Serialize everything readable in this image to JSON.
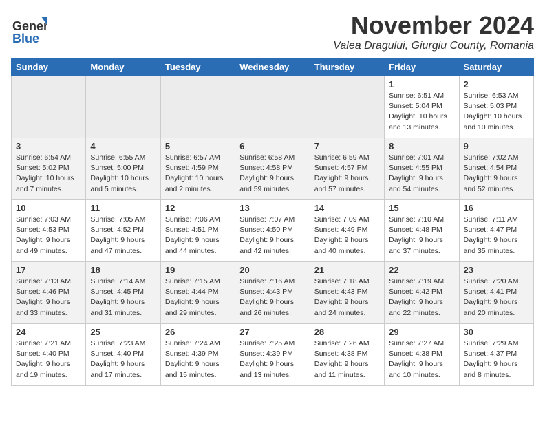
{
  "logo": {
    "general": "General",
    "blue": "Blue"
  },
  "title": "November 2024",
  "location": "Valea Dragului, Giurgiu County, Romania",
  "weekdays": [
    "Sunday",
    "Monday",
    "Tuesday",
    "Wednesday",
    "Thursday",
    "Friday",
    "Saturday"
  ],
  "weeks": [
    [
      {
        "day": "",
        "info": ""
      },
      {
        "day": "",
        "info": ""
      },
      {
        "day": "",
        "info": ""
      },
      {
        "day": "",
        "info": ""
      },
      {
        "day": "",
        "info": ""
      },
      {
        "day": "1",
        "info": "Sunrise: 6:51 AM\nSunset: 5:04 PM\nDaylight: 10 hours\nand 13 minutes."
      },
      {
        "day": "2",
        "info": "Sunrise: 6:53 AM\nSunset: 5:03 PM\nDaylight: 10 hours\nand 10 minutes."
      }
    ],
    [
      {
        "day": "3",
        "info": "Sunrise: 6:54 AM\nSunset: 5:02 PM\nDaylight: 10 hours\nand 7 minutes."
      },
      {
        "day": "4",
        "info": "Sunrise: 6:55 AM\nSunset: 5:00 PM\nDaylight: 10 hours\nand 5 minutes."
      },
      {
        "day": "5",
        "info": "Sunrise: 6:57 AM\nSunset: 4:59 PM\nDaylight: 10 hours\nand 2 minutes."
      },
      {
        "day": "6",
        "info": "Sunrise: 6:58 AM\nSunset: 4:58 PM\nDaylight: 9 hours\nand 59 minutes."
      },
      {
        "day": "7",
        "info": "Sunrise: 6:59 AM\nSunset: 4:57 PM\nDaylight: 9 hours\nand 57 minutes."
      },
      {
        "day": "8",
        "info": "Sunrise: 7:01 AM\nSunset: 4:55 PM\nDaylight: 9 hours\nand 54 minutes."
      },
      {
        "day": "9",
        "info": "Sunrise: 7:02 AM\nSunset: 4:54 PM\nDaylight: 9 hours\nand 52 minutes."
      }
    ],
    [
      {
        "day": "10",
        "info": "Sunrise: 7:03 AM\nSunset: 4:53 PM\nDaylight: 9 hours\nand 49 minutes."
      },
      {
        "day": "11",
        "info": "Sunrise: 7:05 AM\nSunset: 4:52 PM\nDaylight: 9 hours\nand 47 minutes."
      },
      {
        "day": "12",
        "info": "Sunrise: 7:06 AM\nSunset: 4:51 PM\nDaylight: 9 hours\nand 44 minutes."
      },
      {
        "day": "13",
        "info": "Sunrise: 7:07 AM\nSunset: 4:50 PM\nDaylight: 9 hours\nand 42 minutes."
      },
      {
        "day": "14",
        "info": "Sunrise: 7:09 AM\nSunset: 4:49 PM\nDaylight: 9 hours\nand 40 minutes."
      },
      {
        "day": "15",
        "info": "Sunrise: 7:10 AM\nSunset: 4:48 PM\nDaylight: 9 hours\nand 37 minutes."
      },
      {
        "day": "16",
        "info": "Sunrise: 7:11 AM\nSunset: 4:47 PM\nDaylight: 9 hours\nand 35 minutes."
      }
    ],
    [
      {
        "day": "17",
        "info": "Sunrise: 7:13 AM\nSunset: 4:46 PM\nDaylight: 9 hours\nand 33 minutes."
      },
      {
        "day": "18",
        "info": "Sunrise: 7:14 AM\nSunset: 4:45 PM\nDaylight: 9 hours\nand 31 minutes."
      },
      {
        "day": "19",
        "info": "Sunrise: 7:15 AM\nSunset: 4:44 PM\nDaylight: 9 hours\nand 29 minutes."
      },
      {
        "day": "20",
        "info": "Sunrise: 7:16 AM\nSunset: 4:43 PM\nDaylight: 9 hours\nand 26 minutes."
      },
      {
        "day": "21",
        "info": "Sunrise: 7:18 AM\nSunset: 4:43 PM\nDaylight: 9 hours\nand 24 minutes."
      },
      {
        "day": "22",
        "info": "Sunrise: 7:19 AM\nSunset: 4:42 PM\nDaylight: 9 hours\nand 22 minutes."
      },
      {
        "day": "23",
        "info": "Sunrise: 7:20 AM\nSunset: 4:41 PM\nDaylight: 9 hours\nand 20 minutes."
      }
    ],
    [
      {
        "day": "24",
        "info": "Sunrise: 7:21 AM\nSunset: 4:40 PM\nDaylight: 9 hours\nand 19 minutes."
      },
      {
        "day": "25",
        "info": "Sunrise: 7:23 AM\nSunset: 4:40 PM\nDaylight: 9 hours\nand 17 minutes."
      },
      {
        "day": "26",
        "info": "Sunrise: 7:24 AM\nSunset: 4:39 PM\nDaylight: 9 hours\nand 15 minutes."
      },
      {
        "day": "27",
        "info": "Sunrise: 7:25 AM\nSunset: 4:39 PM\nDaylight: 9 hours\nand 13 minutes."
      },
      {
        "day": "28",
        "info": "Sunrise: 7:26 AM\nSunset: 4:38 PM\nDaylight: 9 hours\nand 11 minutes."
      },
      {
        "day": "29",
        "info": "Sunrise: 7:27 AM\nSunset: 4:38 PM\nDaylight: 9 hours\nand 10 minutes."
      },
      {
        "day": "30",
        "info": "Sunrise: 7:29 AM\nSunset: 4:37 PM\nDaylight: 9 hours\nand 8 minutes."
      }
    ]
  ]
}
